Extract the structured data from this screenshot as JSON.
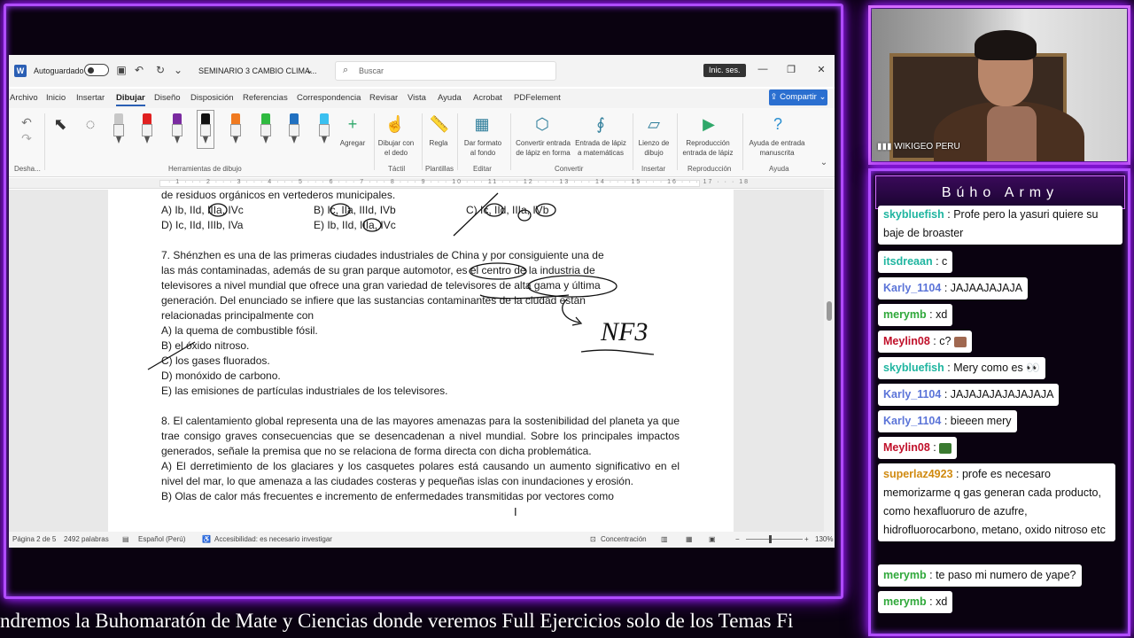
{
  "ticker": "ndremos la Buhomaratón de Mate y Ciencias donde veremos Full Ejercicios solo de los Temas Fi",
  "word": {
    "titlebar": {
      "autosave_label": "Autoguardado",
      "doc_title": "SEMINARIO 3 CAMBIO CLIMA...",
      "search_placeholder": "Buscar",
      "signin_label": "Inic. ses."
    },
    "tabs": [
      "Archivo",
      "Inicio",
      "Insertar",
      "Dibujar",
      "Diseño",
      "Disposición",
      "Referencias",
      "Correspondencia",
      "Revisar",
      "Vista",
      "Ayuda",
      "Acrobat",
      "PDFelement"
    ],
    "active_tab": "Dibujar",
    "share_label": "Compartir",
    "ribbon": {
      "undo_group": "Desha...",
      "tools_group": "Herramientas de dibujo",
      "add_label": "Agregar",
      "finger_label": "Dibujar con el dedo",
      "tactil_group": "Táctil",
      "ruler_label": "Regla",
      "templates_group": "Plantillas",
      "background_label": "Dar formato al fondo",
      "edit_group": "Editar",
      "convert_ink_label": "Convertir entrada de lápiz en forma",
      "math_label": "Entrada de lápiz a matemáticas",
      "convert_group": "Convertir",
      "canvas_label": "Lienzo de dibujo",
      "insert_group": "Insertar",
      "replay_label": "Reproducción entrada de lápiz",
      "replay_group": "Reproducción",
      "help_label": "Ayuda de entrada manuscrita",
      "help_group": "Ayuda"
    },
    "pen_colors": [
      "#c8c8c8",
      "#e02020",
      "#7a2aa0",
      "#111111",
      "#f07a20",
      "#2fba40",
      "#2070c0",
      "#3ac0f0"
    ],
    "ruler_numbers": "· 1 · · · 2 · · · 3 · · · 4 · · · 5 · · · 6 · · · 7 · · · 8 · · · 9 · · · 10 · · · 11 · · · 12 · · · 13 · · · 14 · · · 15 · · · 16 · · · 17 · · · 18",
    "document": {
      "line_top": "de residuos orgánicos en vertederos municipales.",
      "q6_options": {
        "a": "A) Ib, IId, IIIa, IVc",
        "b": "B) Ic, IIa, IIId, IVb",
        "c": "C) Ic, IId, IIIa, IVb",
        "d": "D) Ic, IId, IIIb, IVa",
        "e": "E) Ib, IId, IIIa, IVc"
      },
      "q7_text": "7. Shénzhen es una de las primeras ciudades industriales de China y por consiguiente una de las más contaminadas, además de su gran parque automotor, es el centro de la industria de televisores a nivel mundial que ofrece una gran variedad de televisores de alta gama y última generación. Del enunciado se infiere que las sustancias contaminantes de la ciudad están relacionadas principalmente con",
      "q7_options": [
        "A) la quema de combustible fósil.",
        "B) el óxido nitroso.",
        "C) los gases fluorados.",
        "D) monóxido de carbono.",
        "E) las emisiones de partículas industriales de los televisores."
      ],
      "q8_text": "8. El calentamiento global representa una de las mayores amenazas para la sostenibilidad del planeta ya que trae consigo graves consecuencias que se desencadenan a nivel mundial. Sobre los principales impactos generados, señale la premisa que no se relaciona de forma directa con dicha problemática.",
      "q8_a": "A) El derretimiento de los glaciares y los casquetes polares está causando un aumento significativo en el nivel del mar, lo que amenaza a las ciudades costeras y pequeñas islas con inundaciones y erosión.",
      "q8_b": "B) Olas de calor más frecuentes e incremento de enfermedades transmitidas por vectores como"
    },
    "annotation": "NF3",
    "status": {
      "page": "Página 2 de 5",
      "words": "2492 palabras",
      "language": "Español (Perú)",
      "accessibility": "Accesibilidad: es necesario investigar",
      "focus": "Concentración",
      "zoom": "130%"
    }
  },
  "webcam": {
    "label": "WIKIGEO PERU"
  },
  "chat": {
    "title": "Búho Army",
    "messages": [
      {
        "user": "skybluefish",
        "color": "u-teal",
        "text": "Profe pero la yasuri quiere su baje de broaster"
      },
      {
        "user": "itsdreaan",
        "color": "u-teal",
        "text": "c"
      },
      {
        "user": "Karly_1104",
        "color": "u-blue",
        "text": "JAJAAJAJAJA"
      },
      {
        "user": "merymb",
        "color": "u-green",
        "text": "xd"
      },
      {
        "user": "Meylin08",
        "color": "u-red",
        "text": "c?"
      },
      {
        "user": "skybluefish",
        "color": "u-teal",
        "text": "Mery como es"
      },
      {
        "user": "Karly_1104",
        "color": "u-blue",
        "text": "JAJAJAJAJAJAJAJA"
      },
      {
        "user": "Karly_1104",
        "color": "u-blue",
        "text": "bieeen mery"
      },
      {
        "user": "Meylin08",
        "color": "u-red",
        "text": ""
      },
      {
        "user": "superlaz4923",
        "color": "u-orange",
        "text": "profe es necesaro memorizarme q gas generan cada producto, como hexafluoruro de azufre, hidrofluorocarbono, metano, oxido nitroso etc"
      },
      {
        "user": "merymb",
        "color": "u-green",
        "text": "te paso mi numero de yape?"
      },
      {
        "user": "merymb",
        "color": "u-green",
        "text": "xd"
      }
    ]
  }
}
